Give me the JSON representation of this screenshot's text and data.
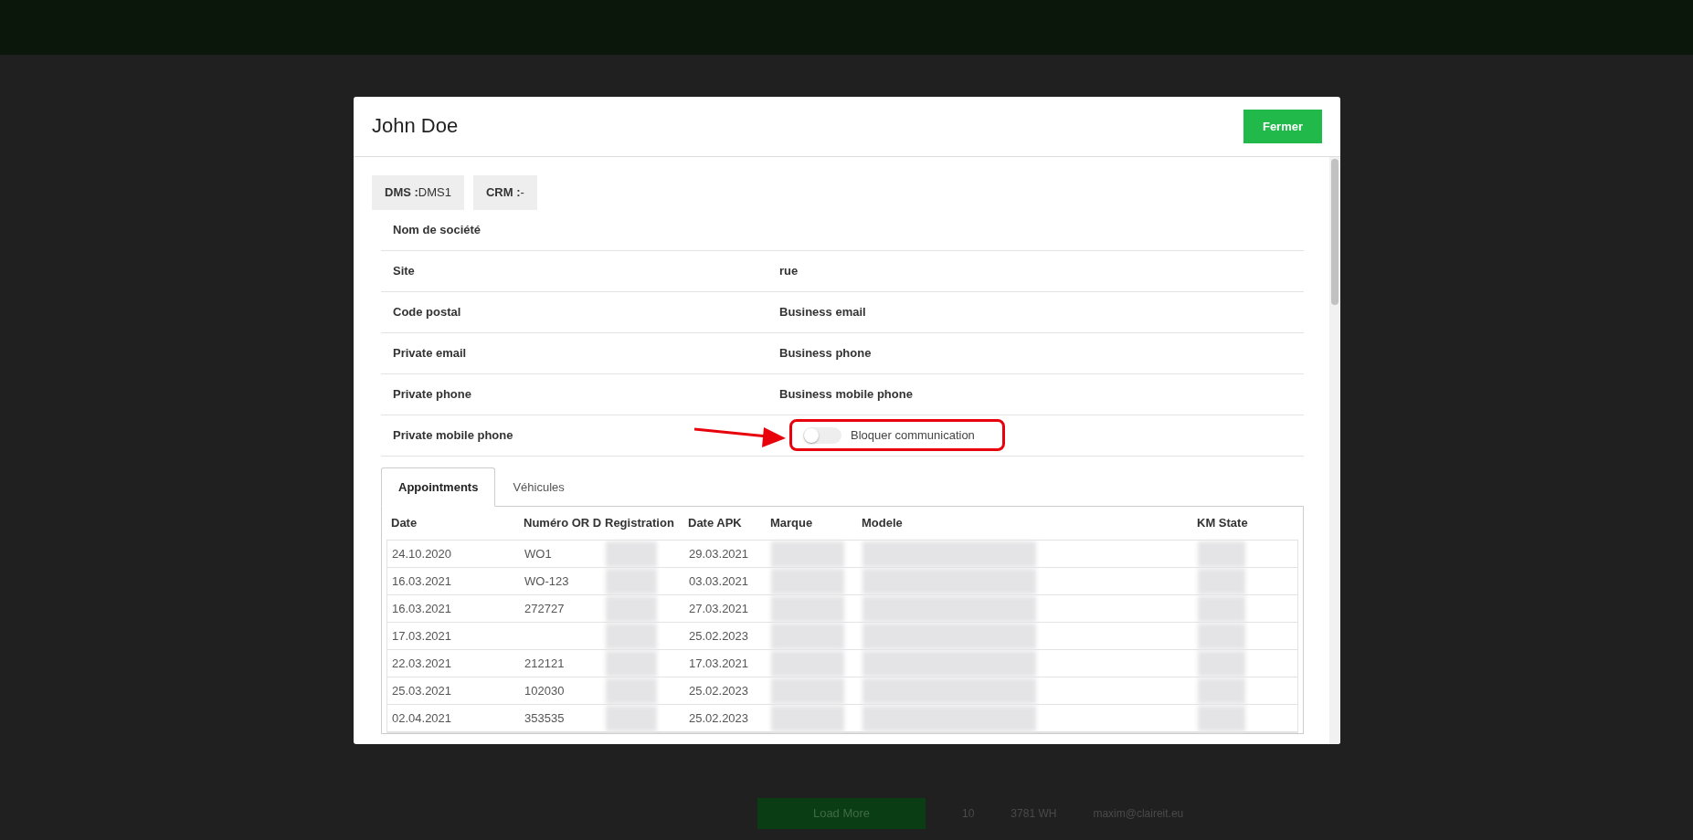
{
  "background": {
    "load_more": "Load More",
    "row_texts": [
      "10",
      "3781 WH",
      "maxim@claireit.eu"
    ]
  },
  "dialog": {
    "title": "John Doe",
    "close_button": "Fermer",
    "badges": [
      {
        "label": "DMS :",
        "value": "DMS1"
      },
      {
        "label": "CRM :",
        "value": "-"
      }
    ],
    "info_rows": [
      {
        "kind": "text",
        "left": "Nom de société"
      },
      {
        "kind": "text",
        "left": "Site",
        "right": "rue"
      },
      {
        "kind": "text",
        "left": "Code postal",
        "right": "Business email"
      },
      {
        "kind": "text",
        "left": "Private email",
        "right": "Business phone"
      },
      {
        "kind": "text",
        "left": "Private phone",
        "right": "Business mobile phone"
      },
      {
        "kind": "toggle",
        "left": "Private mobile phone",
        "toggle_label": "Bloquer communication",
        "on": false,
        "annotated": true
      }
    ],
    "tabs": [
      {
        "label": "Appointments",
        "selected": true
      },
      {
        "label": "Véhicules",
        "selected": false
      }
    ],
    "table": {
      "columns": [
        "Date",
        "Numéro OR D",
        "Registration",
        "Date APK",
        "Marque",
        "Modele",
        "KM State"
      ],
      "rows": [
        {
          "date": "24.10.2020",
          "numero": "WO1",
          "date_apk": "29.03.2021"
        },
        {
          "date": "16.03.2021",
          "numero": "WO-123",
          "date_apk": "03.03.2021"
        },
        {
          "date": "16.03.2021",
          "numero": "272727",
          "date_apk": "27.03.2021"
        },
        {
          "date": "17.03.2021",
          "date_apk": "25.02.2023"
        },
        {
          "date": "22.03.2021",
          "numero": "212121",
          "date_apk": "17.03.2021"
        },
        {
          "date": "25.03.2021",
          "numero": "102030",
          "date_apk": "25.02.2023"
        },
        {
          "date": "02.04.2021",
          "numero": "353535",
          "date_apk": "25.02.2023"
        }
      ]
    }
  }
}
